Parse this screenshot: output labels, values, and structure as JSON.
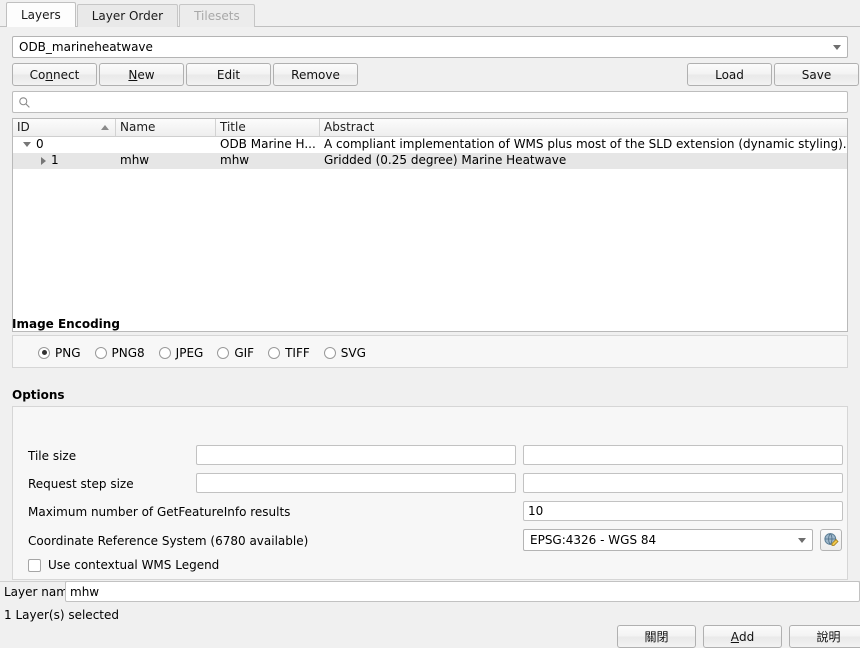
{
  "tabs": [
    {
      "label": "Layers",
      "state": "active"
    },
    {
      "label": "Layer Order",
      "state": "normal"
    },
    {
      "label": "Tilesets",
      "state": "disabled"
    }
  ],
  "connection": {
    "selected": "ODB_marineheatwave",
    "buttons": {
      "connect": "Connect",
      "connect_pre": "Co",
      "connect_mn": "n",
      "connect_post": "nect",
      "new_mn": "N",
      "new_post": "ew",
      "edit": "Edit",
      "remove": "Remove",
      "load": "Load",
      "save": "Save"
    }
  },
  "search": {
    "value": "",
    "placeholder": "",
    "icon": "search-icon"
  },
  "layer_tree": {
    "columns": [
      "ID",
      "Name",
      "Title",
      "Abstract"
    ],
    "sort_column": "ID",
    "sort_direction": "ascending",
    "rows": [
      {
        "id": "0",
        "name": "",
        "title": "ODB Marine H...",
        "abstract": "A compliant implementation of WMS plus most of the SLD extension (dynamic styling). Can a...",
        "expander": "expanded",
        "depth": 0,
        "selected": false
      },
      {
        "id": "1",
        "name": "mhw",
        "title": "mhw",
        "abstract": "Gridded (0.25 degree) Marine Heatwave",
        "expander": "collapsed",
        "depth": 1,
        "selected": true
      }
    ]
  },
  "image_encoding": {
    "title": "Image Encoding",
    "selected": "PNG",
    "options": [
      "PNG",
      "PNG8",
      "JPEG",
      "GIF",
      "TIFF",
      "SVG"
    ]
  },
  "options": {
    "title": "Options",
    "tile_size": {
      "label": "Tile size",
      "width": "",
      "height": ""
    },
    "request_step_size": {
      "label": "Request step size",
      "width": "",
      "height": ""
    },
    "max_getfeatureinfo": {
      "label": "Maximum number of GetFeatureInfo results",
      "value": "10"
    },
    "crs": {
      "label": "Coordinate Reference System (6780 available)",
      "value": "EPSG:4326 - WGS 84",
      "button_icon": "globe-select-crs-icon"
    },
    "contextual_legend": {
      "label": "Use contextual WMS Legend",
      "checked": false
    }
  },
  "footer": {
    "layer_name_label": "Layer name",
    "layer_name_value": "mhw",
    "status": "1 Layer(s) selected",
    "close_button": "關閉",
    "add_button_mn": "A",
    "add_button_post": "dd",
    "help_button": "說明"
  }
}
